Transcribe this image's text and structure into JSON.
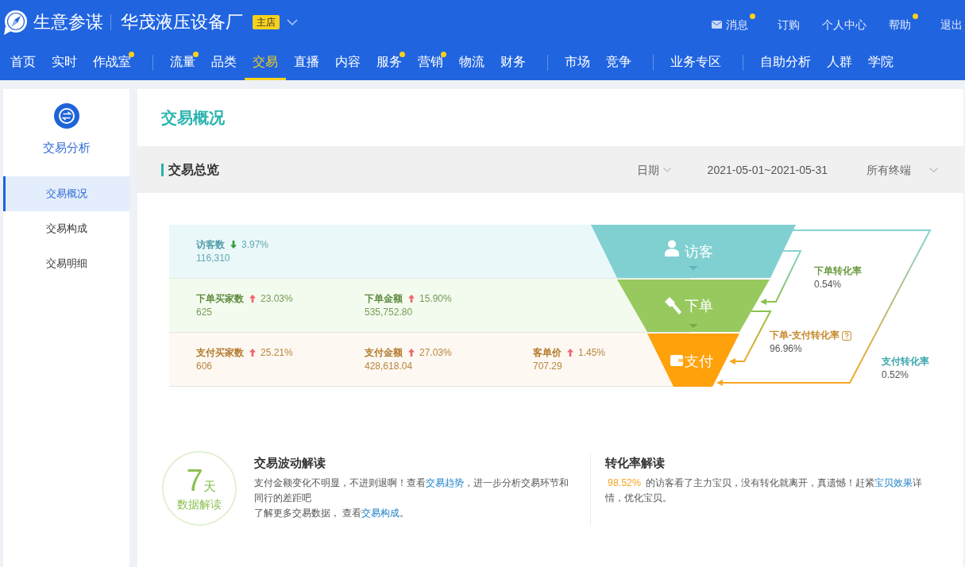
{
  "header": {
    "app_name": "生意参谋",
    "shop_name": "华茂液压设备厂",
    "shop_tag": "主店",
    "links": [
      {
        "label": "消息",
        "kind": "mail",
        "dot": true
      },
      {
        "label": "订购",
        "kind": "plain",
        "dot": false
      },
      {
        "label": "个人中心",
        "kind": "plain",
        "dot": false
      },
      {
        "label": "帮助",
        "kind": "plain",
        "dot": true
      },
      {
        "label": "退出",
        "kind": "plain",
        "dot": false
      }
    ]
  },
  "nav": {
    "groups": [
      {
        "items": [
          {
            "label": "首页",
            "selected": false,
            "dot": false
          },
          {
            "label": "实时",
            "selected": false,
            "dot": false
          },
          {
            "label": "作战室",
            "selected": false,
            "dot": true
          }
        ]
      },
      {
        "items": [
          {
            "label": "流量",
            "selected": false,
            "dot": true
          },
          {
            "label": "品类",
            "selected": false,
            "dot": false
          },
          {
            "label": "交易",
            "selected": true,
            "dot": false
          },
          {
            "label": "直播",
            "selected": false,
            "dot": false
          },
          {
            "label": "内容",
            "selected": false,
            "dot": false
          },
          {
            "label": "服务",
            "selected": false,
            "dot": true
          },
          {
            "label": "营销",
            "selected": false,
            "dot": true
          },
          {
            "label": "物流",
            "selected": false,
            "dot": false
          },
          {
            "label": "财务",
            "selected": false,
            "dot": false
          }
        ]
      },
      {
        "items": [
          {
            "label": "市场",
            "selected": false,
            "dot": false
          },
          {
            "label": "竞争",
            "selected": false,
            "dot": false
          }
        ]
      },
      {
        "items": [
          {
            "label": "业务专区",
            "selected": false,
            "dot": false
          }
        ]
      },
      {
        "items": [
          {
            "label": "自助分析",
            "selected": false,
            "dot": false
          },
          {
            "label": "人群",
            "selected": false,
            "dot": false
          },
          {
            "label": "学院",
            "selected": false,
            "dot": false
          }
        ]
      }
    ]
  },
  "sidebar": {
    "title": "交易分析",
    "items": [
      {
        "label": "交易概况",
        "selected": true
      },
      {
        "label": "交易构成",
        "selected": false
      },
      {
        "label": "交易明细",
        "selected": false
      }
    ]
  },
  "page_title": "交易概况",
  "overview": {
    "title": "交易总览",
    "date_label": "日期",
    "date_range": "2021-05-01~2021-05-31",
    "terminal": "所有终端",
    "rows": [
      {
        "kind": "visitor",
        "metrics": [
          {
            "label": "访客数",
            "up": false,
            "change": "3.97%",
            "value": "116,310"
          }
        ]
      },
      {
        "kind": "order",
        "metrics": [
          {
            "label": "下单买家数",
            "up": true,
            "change": "23.03%",
            "value": "625"
          },
          {
            "label": "下单金额",
            "up": true,
            "change": "15.90%",
            "value": "535,752.80"
          }
        ]
      },
      {
        "kind": "pay",
        "metrics": [
          {
            "label": "支付买家数",
            "up": true,
            "change": "25.21%",
            "value": "606"
          },
          {
            "label": "支付金额",
            "up": true,
            "change": "27.03%",
            "value": "428,618.04"
          },
          {
            "label": "客单价",
            "up": true,
            "change": "1.45%",
            "value": "707.29"
          }
        ]
      }
    ],
    "funnel": {
      "stages": [
        {
          "kind": "visitor",
          "label": "访客"
        },
        {
          "kind": "order",
          "label": "下单"
        },
        {
          "kind": "pay",
          "label": "支付"
        }
      ],
      "rates": [
        {
          "kind": "order",
          "label": "下单转化率",
          "value": "0.54%",
          "help": false
        },
        {
          "kind": "order_pay",
          "label": "下单-支付转化率",
          "value": "96.96%",
          "help": true
        },
        {
          "kind": "pay",
          "label": "支付转化率",
          "value": "0.52%",
          "help": false
        }
      ]
    }
  },
  "insights": {
    "badge": {
      "number": "7",
      "unit": "天",
      "label": "数据解读"
    },
    "cards": [
      {
        "title": "交易波动解读",
        "paragraphs": [
          [
            {
              "kind": "text",
              "text": "支付金额变化不明显，不进则退啊！查看"
            },
            {
              "kind": "link",
              "text": "交易趋势"
            },
            {
              "kind": "text",
              "text": "，进一步分析交易环节和同行的差距吧"
            }
          ],
          [
            {
              "kind": "text",
              "text": "了解更多交易数据， 查看"
            },
            {
              "kind": "link",
              "text": "交易构成"
            },
            {
              "kind": "text",
              "text": "。"
            }
          ]
        ]
      },
      {
        "title": "转化率解读",
        "paragraphs": [
          [
            {
              "kind": "highlight",
              "text": "98.52%"
            },
            {
              "kind": "text",
              "text": " 的访客看了主力宝贝，没有转化就离开，真遗憾！赶紧"
            },
            {
              "kind": "link",
              "text": "宝贝效果"
            },
            {
              "kind": "text",
              "text": "详情，优化宝贝。"
            }
          ]
        ]
      }
    ]
  }
}
